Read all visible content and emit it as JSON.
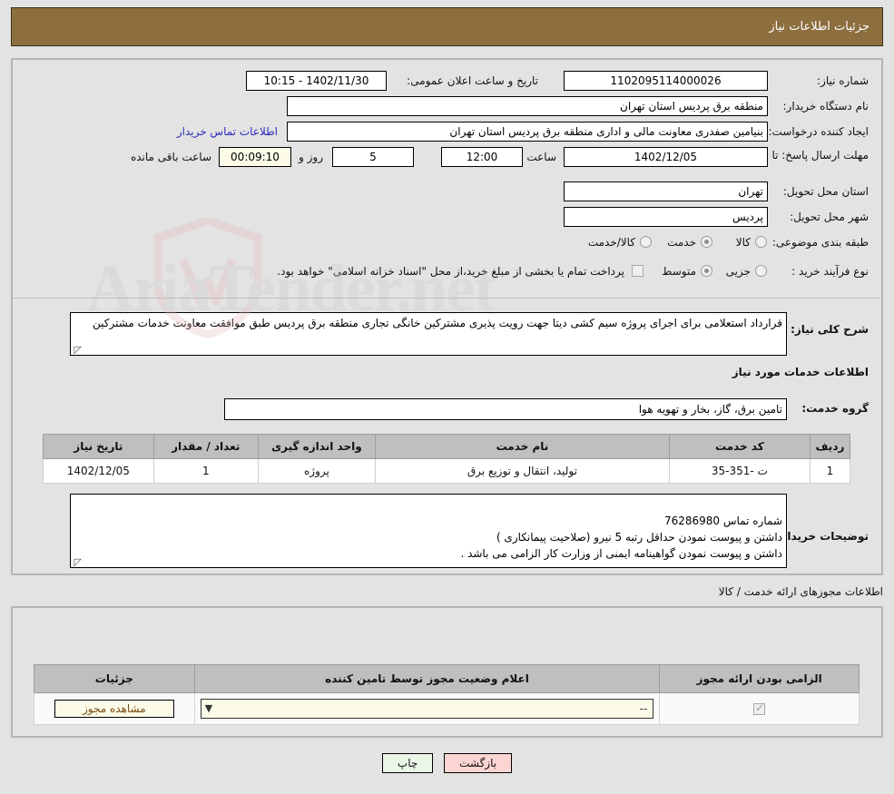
{
  "header": {
    "title": "جزئیات اطلاعات نیاز"
  },
  "fields": {
    "need_number_label": "شماره نیاز:",
    "need_number_value": "1102095114000026",
    "announce_label": "تاریخ و ساعت اعلان عمومی:",
    "announce_value": "1402/11/30 - 10:15",
    "buyer_org_label": "نام دستگاه خریدار:",
    "buyer_org_value": "منطقه برق پردیس استان تهران",
    "creator_label": "ایجاد کننده درخواست:",
    "creator_value": "بنیامین صفدری معاونت مالی و اداری منطقه برق پردیس استان تهران",
    "contact_link": "اطلاعات تماس خریدار",
    "deadline_label": "مهلت ارسال پاسخ: تا تاریخ:",
    "deadline_date": "1402/12/05",
    "deadline_time_label": "ساعت",
    "deadline_time": "12:00",
    "days_value": "5",
    "days_label": "روز و",
    "countdown_value": "00:09:10",
    "countdown_label": "ساعت باقی مانده",
    "province_label": "استان محل تحویل:",
    "province_value": "تهران",
    "city_label": "شهر محل تحویل:",
    "city_value": "پردیس",
    "category_label": "طبقه بندی موضوعی:",
    "process_label": "نوع فرآیند خرید :",
    "process_note": "پرداخت تمام یا بخشی از مبلغ خرید،از محل \"اسناد خزانه اسلامی\" خواهد بود.",
    "summary_label": "شرح کلی نیاز:",
    "summary_value": "قرارداد استعلامی برای اجرای پروژه سیم کشی دیتا جهت رویت پذیری مشترکین خانگی تجاری منطقه برق پردیس  طبق موافقت معاونت خدمات مشترکین",
    "services_heading": "اطلاعات خدمات مورد نیاز",
    "service_group_label": "گروه خدمت:",
    "service_group_value": "تامین برق، گاز، بخار و تهویه هوا",
    "buyer_notes_label": "توضیحات خریدار:",
    "buyer_notes_value": "شماره تماس 76286980\nداشتن و پیوست نمودن حداقل رتبه 5 نیرو (صلاحیت پیمانکاری )\nداشتن و پیوست نمودن گواهینامه ایمنی از وزارت کار الزامی می باشد ."
  },
  "category_options": [
    {
      "label": "کالا",
      "selected": false
    },
    {
      "label": "خدمت",
      "selected": true
    },
    {
      "label": "کالا/خدمت",
      "selected": false
    }
  ],
  "process_options": [
    {
      "label": "جزیی",
      "selected": false
    },
    {
      "label": "متوسط",
      "selected": true
    }
  ],
  "services_table": {
    "headers": [
      "ردیف",
      "کد خدمت",
      "نام خدمت",
      "واحد اندازه گیری",
      "تعداد / مقدار",
      "تاریخ نیاز"
    ],
    "rows": [
      {
        "row": "1",
        "code": "ت -351-35",
        "name": "تولید، انتقال و توزیع برق",
        "unit": "پروژه",
        "qty": "1",
        "date": "1402/12/05"
      }
    ]
  },
  "permits": {
    "caption": "اطلاعات مجوزهای ارائه خدمت / کالا",
    "headers": [
      "الزامی بودن ارائه مجوز",
      "اعلام وضعیت مجوز توسط تامین کننده",
      "جزئیات"
    ],
    "rows": [
      {
        "required": true,
        "status_value": "--",
        "details_label": "مشاهده مجوز"
      }
    ]
  },
  "footer": {
    "print_label": "چاپ",
    "back_label": "بازگشت"
  },
  "watermark": {
    "text": "AriaTender.net"
  },
  "colors": {
    "header_bg": "#8d6e3e",
    "link": "#2b2bbd",
    "print_btn": "#eaf6e8",
    "back_btn": "#fbd5d2",
    "cream": "#fbfbe8"
  }
}
